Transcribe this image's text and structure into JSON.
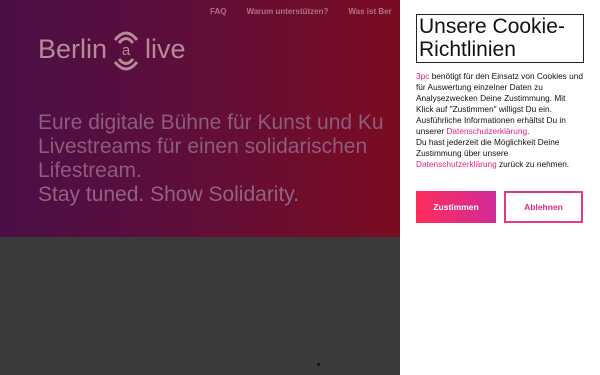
{
  "nav": {
    "items": [
      "FAQ",
      "Warum unterstützen?",
      "Was ist Ber"
    ]
  },
  "logo": {
    "left": "Berlin",
    "middle": "a",
    "right": "live"
  },
  "hero": {
    "lines": [
      "Eure digitale Bühne für Kunst und Ku",
      "Livestreams für einen solidarischen",
      "Lifestream.",
      "Stay tuned. Show Solidarity."
    ]
  },
  "cookie": {
    "title": "Unsere Cookie-Richtlinien",
    "brand": "3pc",
    "p1": " benötigt für den Einsatz von Cookies und für Auswertung einzelner Daten zu Analysezwecken Deine Zustimmung. Mit Klick auf \"Zustimmen\" willigst Du ein. Ausführliche Informationen erhältst Du in unserer ",
    "link1": "Datenschutzerklärung",
    "p1_end": ".",
    "p2": "Du hast jederzeit die Möglichkeit Deine Zustimmung über unsere ",
    "link2": "Datenschutzerklärung",
    "p2_end": " zurück zu nehmen.",
    "accept_label": "Zustimmen",
    "decline_label": "Ablehnen"
  },
  "colors": {
    "accent": "#e8207a",
    "hero_left": "#4a0f46",
    "hero_right": "#7a0c18",
    "lower_bg": "#3a3a3a"
  }
}
